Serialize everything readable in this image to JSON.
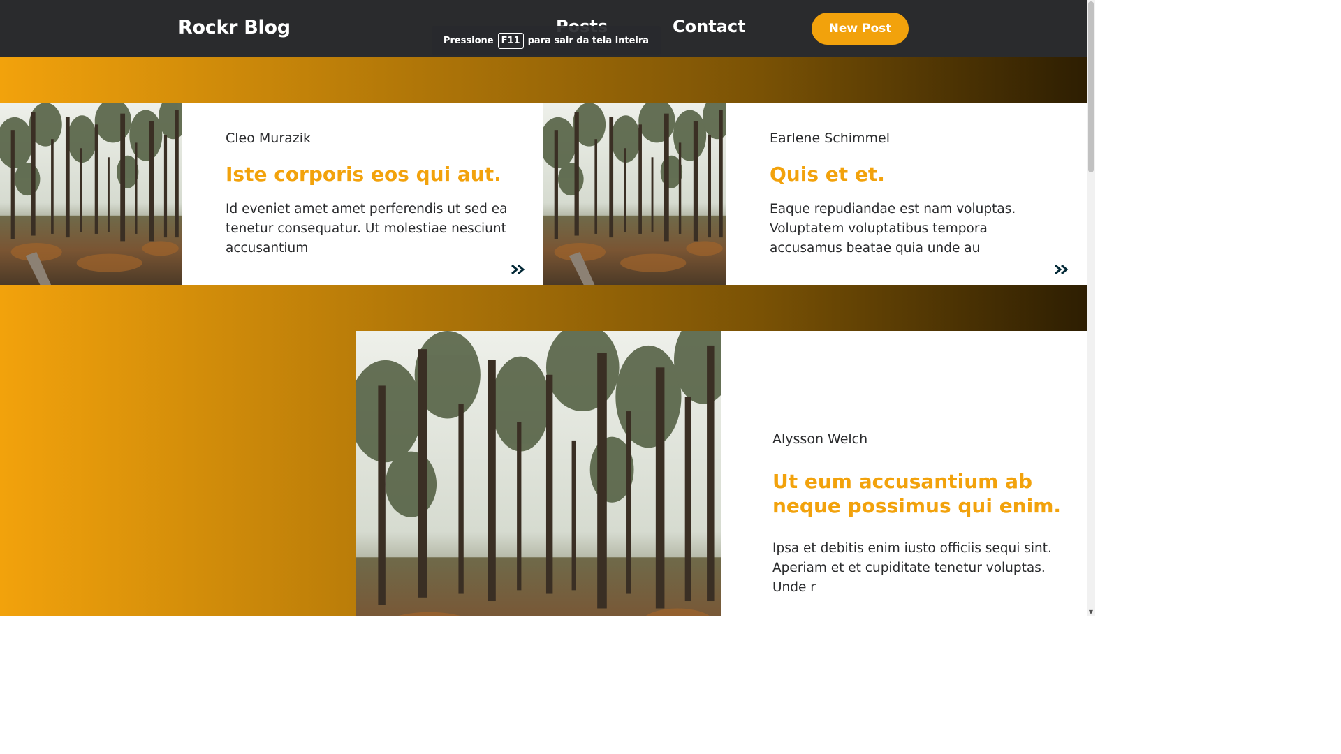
{
  "header": {
    "logo": "Rockr Blog",
    "nav": {
      "posts": "Posts",
      "contact": "Contact"
    },
    "new_post_label": "New Post"
  },
  "toast": {
    "prefix": "Pressione",
    "key": "F11",
    "suffix": "para sair da tela inteira"
  },
  "posts": [
    {
      "author": "Cleo Murazik",
      "title": "Iste corporis eos qui aut.",
      "excerpt": "Id eveniet amet amet perferendis ut sed ea tenetur consequatur. Ut molestiae nesciunt accusantium"
    },
    {
      "author": "Earlene Schimmel",
      "title": "Quis et et.",
      "excerpt": "Eaque repudiandae est nam voluptas. Voluptatem voluptatibus tempora accusamus beatae quia unde au"
    },
    {
      "author": "Alysson Welch",
      "title": "Ut eum accusantium ab neque possimus qui enim.",
      "excerpt": "Ipsa et debitis enim iusto officiis sequi sint. Aperiam et et cupiditate tenetur voluptas. Unde r"
    }
  ],
  "colors": {
    "header_bg": "#2a2b2d",
    "accent": "#f2a20c",
    "gradient_end": "#2d1e02",
    "text": "#2a2b2d",
    "arrow": "#032937"
  },
  "icons": {
    "read_more": "double-chevron-right-icon",
    "post_image": "forest-photo"
  }
}
